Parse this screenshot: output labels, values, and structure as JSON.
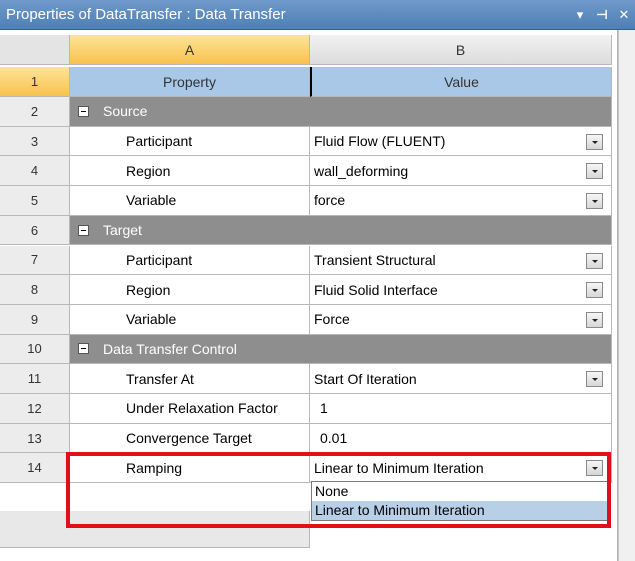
{
  "window": {
    "title": "Properties of DataTransfer : Data Transfer",
    "controls": [
      "▾",
      "⊣",
      "✕"
    ]
  },
  "columns": {
    "a": "A",
    "b": "B"
  },
  "header_row": {
    "num": "1",
    "property": "Property",
    "value": "Value"
  },
  "rows": [
    {
      "num": "2",
      "type": "group",
      "label": "Source"
    },
    {
      "num": "3",
      "type": "prop",
      "label": "Participant",
      "value": "Fluid Flow (FLUENT)",
      "dropdown": true
    },
    {
      "num": "4",
      "type": "prop",
      "label": "Region",
      "value": "wall_deforming",
      "dropdown": true
    },
    {
      "num": "5",
      "type": "prop",
      "label": "Variable",
      "value": "force",
      "dropdown": true
    },
    {
      "num": "6",
      "type": "group",
      "label": "Target"
    },
    {
      "num": "7",
      "type": "prop",
      "label": "Participant",
      "value": "Transient Structural",
      "dropdown": true
    },
    {
      "num": "8",
      "type": "prop",
      "label": "Region",
      "value": "Fluid Solid Interface",
      "dropdown": true
    },
    {
      "num": "9",
      "type": "prop",
      "label": "Variable",
      "value": "Force",
      "dropdown": true
    },
    {
      "num": "10",
      "type": "group",
      "label": "Data Transfer Control"
    },
    {
      "num": "11",
      "type": "prop",
      "label": "Transfer At",
      "value": "Start Of Iteration",
      "dropdown": true
    },
    {
      "num": "12",
      "type": "prop",
      "label": "Under Relaxation Factor",
      "value": "1",
      "dropdown": false
    },
    {
      "num": "13",
      "type": "prop",
      "label": "Convergence Target",
      "value": "0.01",
      "dropdown": false
    },
    {
      "num": "14",
      "type": "prop",
      "label": "Ramping",
      "value": "Linear to Minimum Iteration",
      "dropdown": true
    }
  ],
  "ramping_options": [
    "None",
    "Linear to Minimum Iteration"
  ],
  "ramping_selected": "Linear to Minimum Iteration",
  "colors": {
    "titlebar": "#4f7fb6",
    "group_row": "#8e8e8e",
    "header_selected": "#a9c8e8",
    "highlight": "#e0101a"
  }
}
